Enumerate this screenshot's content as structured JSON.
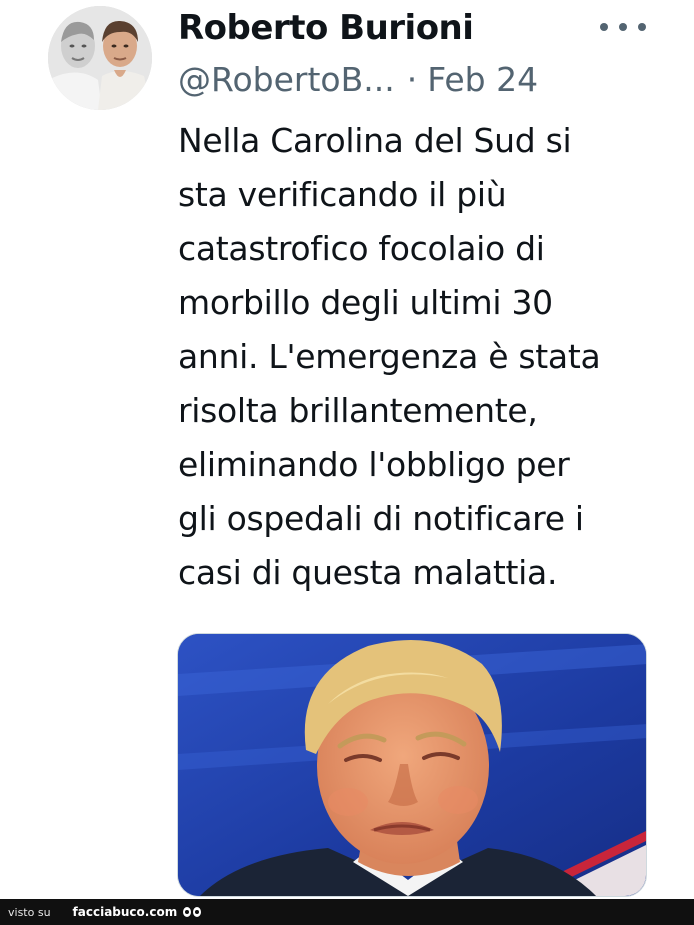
{
  "tweet": {
    "author_name": "Roberto Burioni",
    "handle": "@RobertoB...",
    "separator": "·",
    "date": "Feb 24",
    "text": "Nella Carolina del Sud si\nsta verificando il più\ncatastrofico focolaio di\nmorbillo degli ultimi 30\nanni. L'emergenza è stata\nrisolta brillantemente,\neliminando l'obbligo per\ngli ospedali di notificare i\ncasi di questa malattia.",
    "more_icon": "more-horizontal-icon"
  },
  "footer": {
    "prefix": "visto su",
    "site": "facciabuco.com",
    "logo_icon": "eyes-icon"
  },
  "colors": {
    "text_primary": "#0f1419",
    "text_secondary": "#536471",
    "footer_bg": "#101010",
    "media_background_blue": "#1c3fa8"
  }
}
